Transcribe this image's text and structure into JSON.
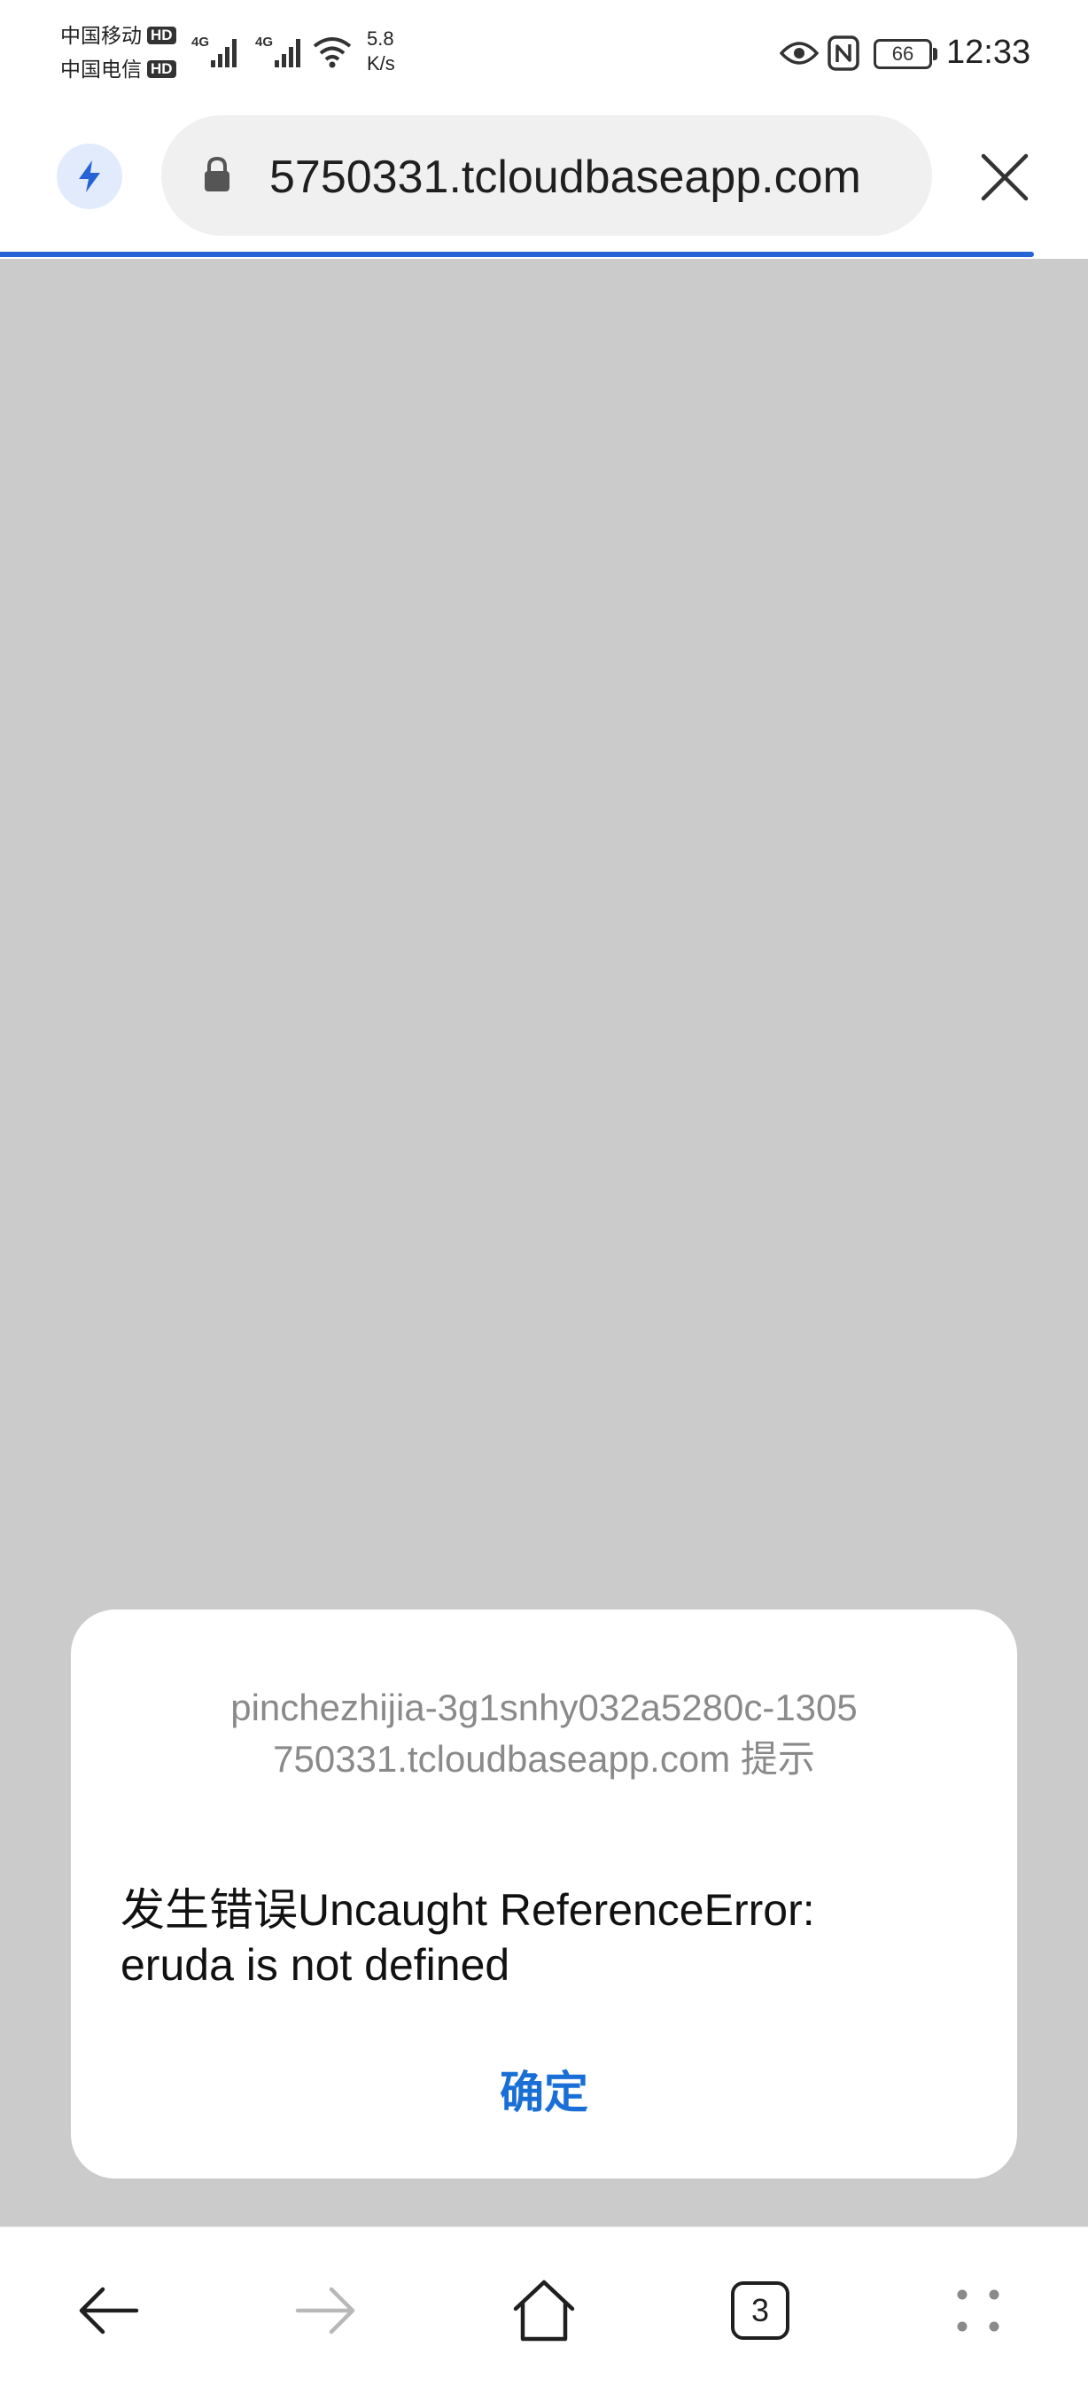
{
  "status_bar": {
    "carrier_1": "中国移动",
    "carrier_2": "中国电信",
    "hd_badge": "HD",
    "net_type": "4G",
    "net_speed_value": "5.8",
    "net_speed_unit": "K/s",
    "battery": "66",
    "time": "12:33",
    "icons": [
      "signal-icon",
      "wifi-icon",
      "eye-icon",
      "nfc-icon",
      "battery-icon"
    ]
  },
  "address_bar": {
    "url": "5750331.tcloudbaseapp.com",
    "icons": [
      "bolt-icon",
      "lock-icon",
      "close-icon"
    ],
    "accent_color": "#2563d6",
    "load_progress": 0.95
  },
  "dialog": {
    "title": "pinchezhijia-3g1snhy032a5280c-1305750331.tcloudbaseapp.com 提示",
    "message": "发生错误Uncaught ReferenceError: eruda is not defined",
    "ok_label": "确定",
    "ok_color": "#1a6fd6"
  },
  "bottom_nav": {
    "tab_count": "3",
    "icons": [
      "back-arrow-icon",
      "forward-arrow-icon",
      "home-icon",
      "tabs-icon",
      "more-menu-icon"
    ]
  }
}
